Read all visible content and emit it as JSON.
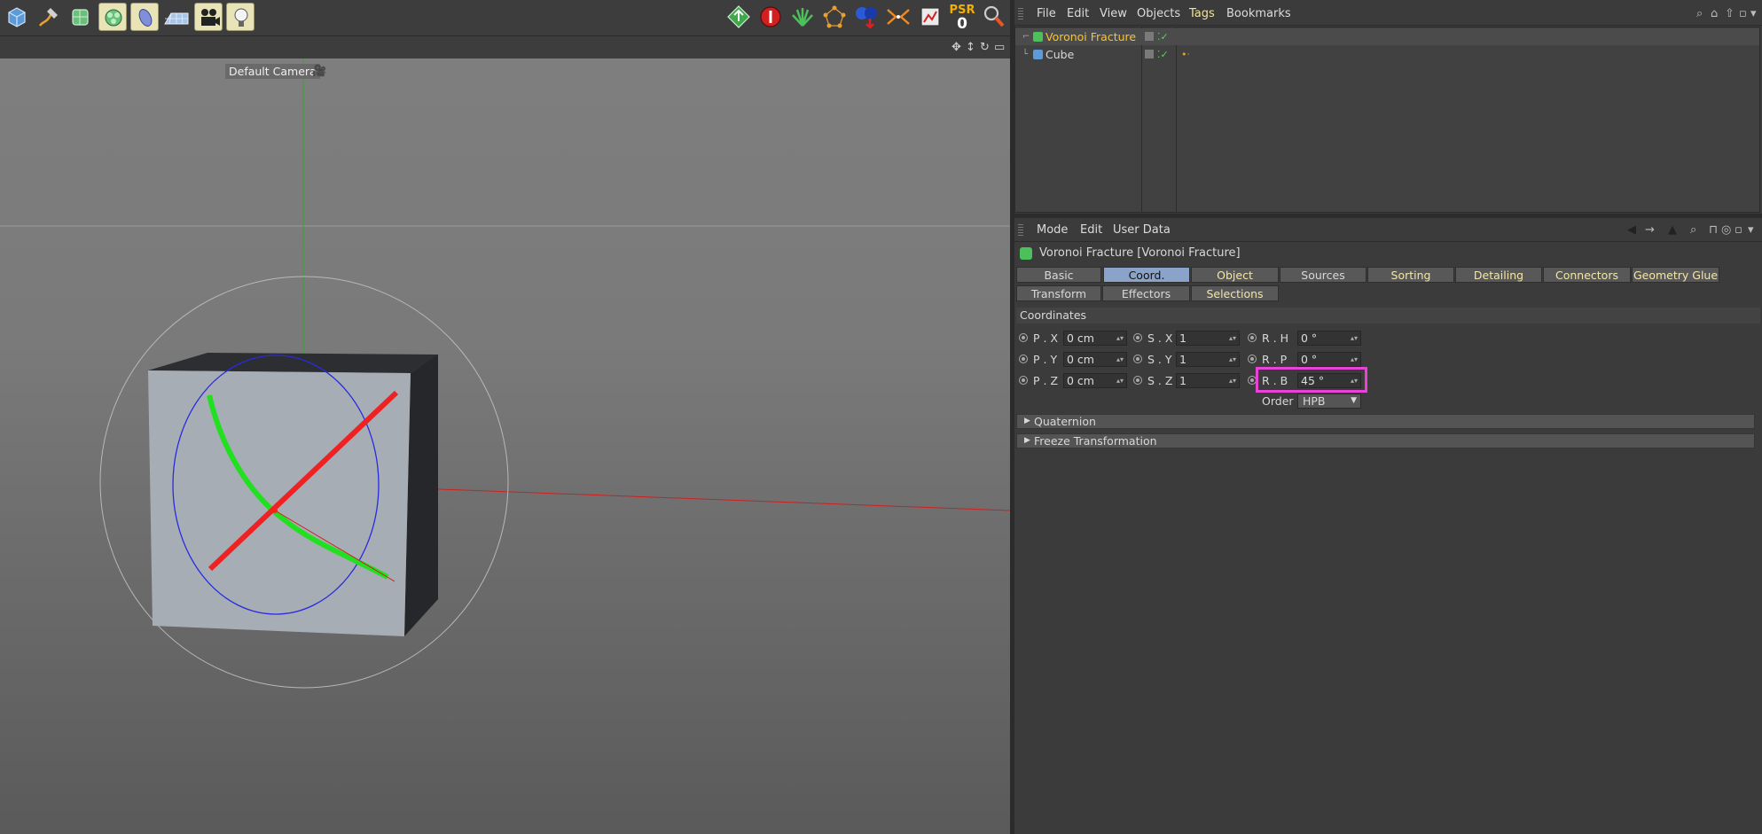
{
  "viewport": {
    "camera_label": "Default Camera",
    "psr_label": "PSR",
    "psr_value": "0"
  },
  "object_manager": {
    "menu": [
      "File",
      "Edit",
      "View",
      "Objects",
      "Tags",
      "Bookmarks"
    ],
    "objects": [
      {
        "name": "Voronoi Fracture",
        "active": true
      },
      {
        "name": "Cube",
        "active": false
      }
    ]
  },
  "attribute_manager": {
    "menu": [
      "Mode",
      "Edit",
      "User Data"
    ],
    "title": "Voronoi Fracture [Voronoi Fracture]",
    "tabs_row1": [
      "Basic",
      "Coord.",
      "Object",
      "Sources",
      "Sorting",
      "Detailing",
      "Connectors",
      "Geometry Glue"
    ],
    "tabs_row2": [
      "Transform",
      "Effectors",
      "Selections"
    ],
    "active_tab": "Coord.",
    "section": "Coordinates",
    "position": {
      "x_label": "P . X",
      "x": "0 cm",
      "y_label": "P . Y",
      "y": "0 cm",
      "z_label": "P . Z",
      "z": "0 cm"
    },
    "scale": {
      "x_label": "S . X",
      "x": "1",
      "y_label": "S . Y",
      "y": "1",
      "z_label": "S . Z",
      "z": "1"
    },
    "rotation": {
      "h_label": "R . H",
      "h": "0 °",
      "p_label": "R . P",
      "p": "0 °",
      "b_label": "R . B",
      "b": "45 °"
    },
    "order_label": "Order",
    "order_value": "HPB",
    "groups": [
      "Quaternion",
      "Freeze Transformation"
    ]
  },
  "colors": {
    "active_object": "#f6c33b",
    "active_tab": "#8aa3c8",
    "highlight_box": "#e743d6"
  }
}
